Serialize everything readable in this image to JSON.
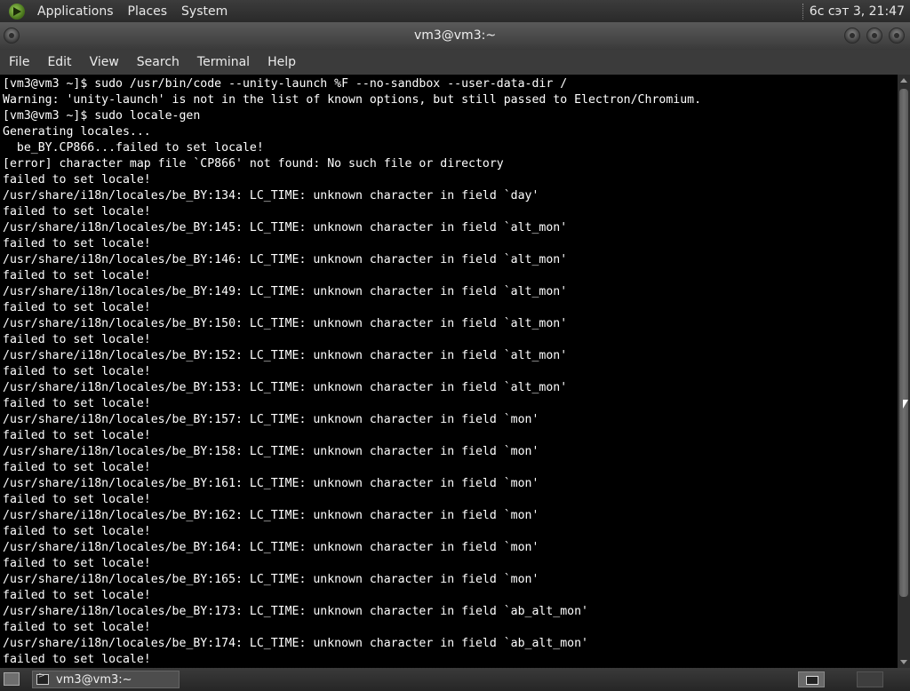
{
  "top_panel": {
    "menus": [
      "Applications",
      "Places",
      "System"
    ],
    "clock": "6с сэт  3, 21:47"
  },
  "window": {
    "title": "vm3@vm3:~"
  },
  "menubar": {
    "items": [
      "File",
      "Edit",
      "View",
      "Search",
      "Terminal",
      "Help"
    ]
  },
  "terminal": {
    "lines": [
      "[vm3@vm3 ~]$ sudo /usr/bin/code --unity-launch %F --no-sandbox --user-data-dir /",
      "Warning: 'unity-launch' is not in the list of known options, but still passed to Electron/Chromium.",
      "[vm3@vm3 ~]$ sudo locale-gen",
      "Generating locales...",
      "  be_BY.CP866...failed to set locale!",
      "[error] character map file `CP866' not found: No such file or directory",
      "failed to set locale!",
      "/usr/share/i18n/locales/be_BY:134: LC_TIME: unknown character in field `day'",
      "failed to set locale!",
      "/usr/share/i18n/locales/be_BY:145: LC_TIME: unknown character in field `alt_mon'",
      "failed to set locale!",
      "/usr/share/i18n/locales/be_BY:146: LC_TIME: unknown character in field `alt_mon'",
      "failed to set locale!",
      "/usr/share/i18n/locales/be_BY:149: LC_TIME: unknown character in field `alt_mon'",
      "failed to set locale!",
      "/usr/share/i18n/locales/be_BY:150: LC_TIME: unknown character in field `alt_mon'",
      "failed to set locale!",
      "/usr/share/i18n/locales/be_BY:152: LC_TIME: unknown character in field `alt_mon'",
      "failed to set locale!",
      "/usr/share/i18n/locales/be_BY:153: LC_TIME: unknown character in field `alt_mon'",
      "failed to set locale!",
      "/usr/share/i18n/locales/be_BY:157: LC_TIME: unknown character in field `mon'",
      "failed to set locale!",
      "/usr/share/i18n/locales/be_BY:158: LC_TIME: unknown character in field `mon'",
      "failed to set locale!",
      "/usr/share/i18n/locales/be_BY:161: LC_TIME: unknown character in field `mon'",
      "failed to set locale!",
      "/usr/share/i18n/locales/be_BY:162: LC_TIME: unknown character in field `mon'",
      "failed to set locale!",
      "/usr/share/i18n/locales/be_BY:164: LC_TIME: unknown character in field `mon'",
      "failed to set locale!",
      "/usr/share/i18n/locales/be_BY:165: LC_TIME: unknown character in field `mon'",
      "failed to set locale!",
      "/usr/share/i18n/locales/be_BY:173: LC_TIME: unknown character in field `ab_alt_mon'",
      "failed to set locale!",
      "/usr/share/i18n/locales/be_BY:174: LC_TIME: unknown character in field `ab_alt_mon'",
      "failed to set locale!"
    ]
  },
  "taskbar": {
    "task_label": "vm3@vm3:~"
  }
}
